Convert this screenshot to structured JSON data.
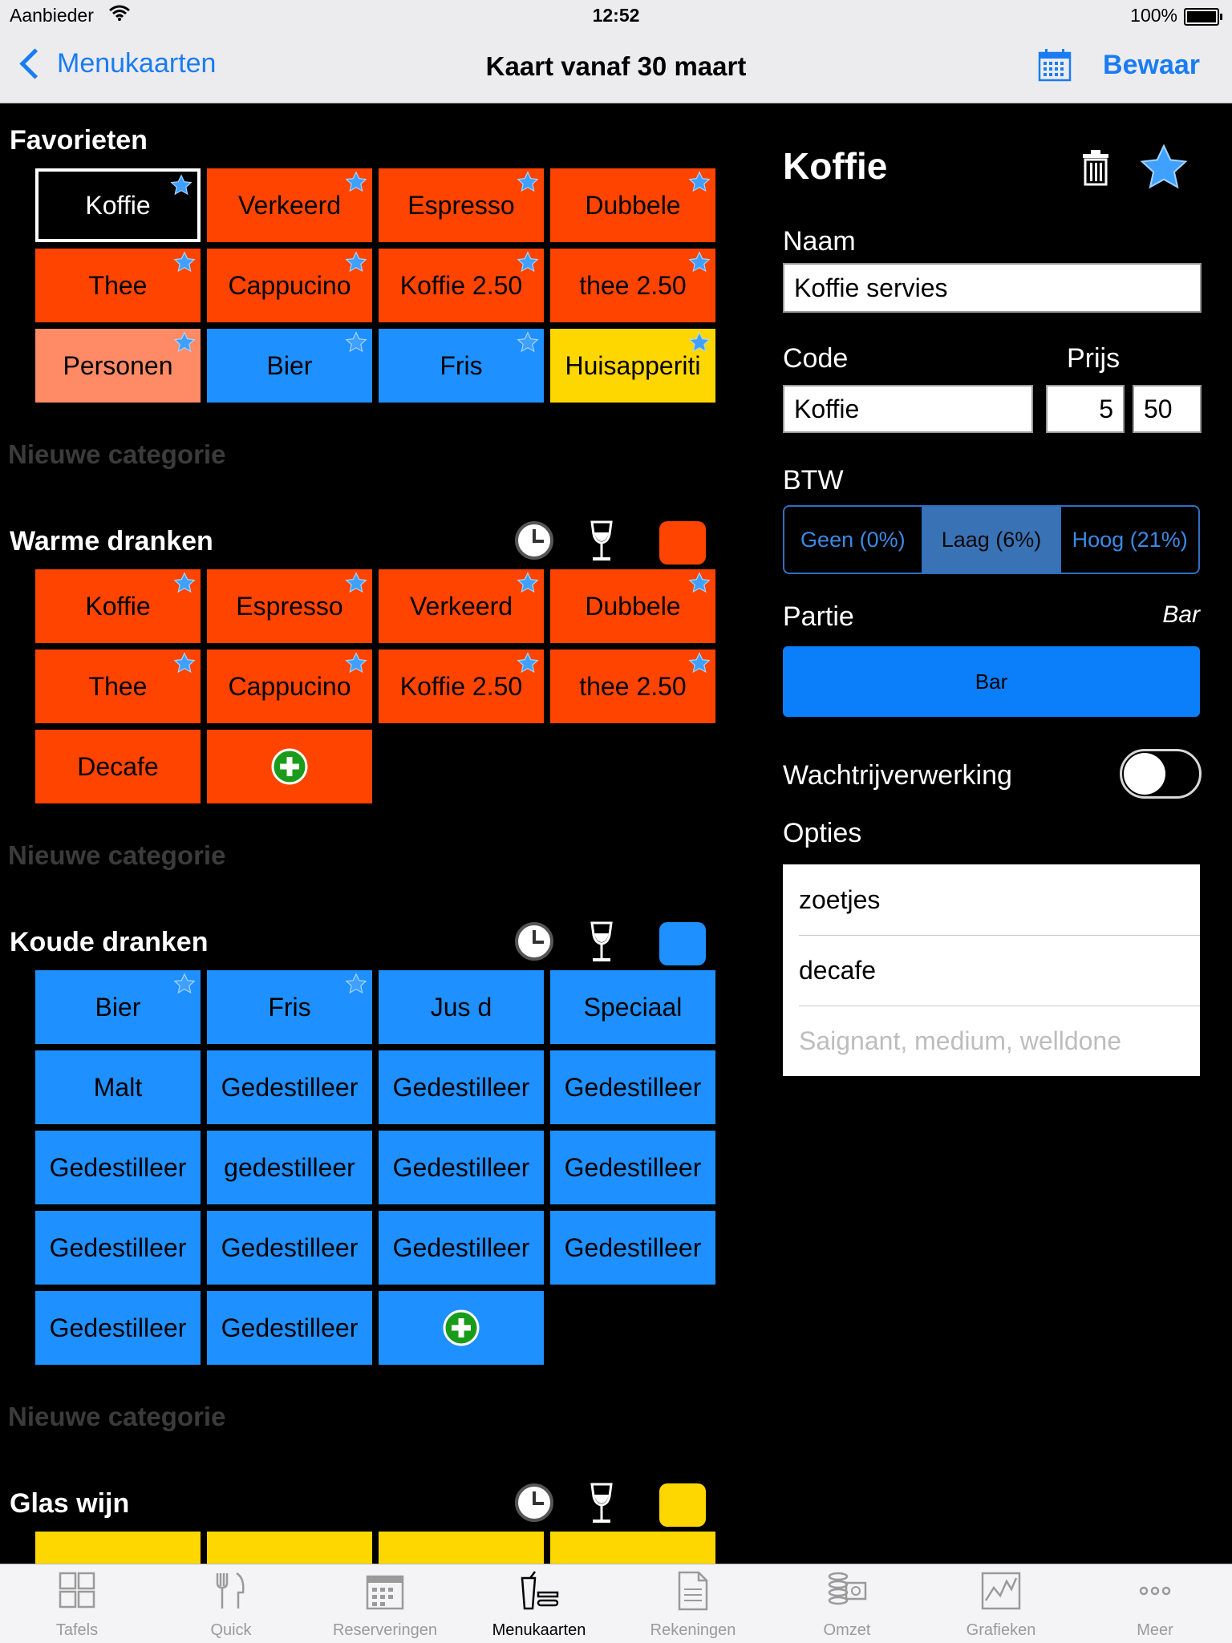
{
  "status": {
    "carrier": "Aanbieder",
    "time": "12:52",
    "battery": "100%"
  },
  "nav": {
    "back_label": "Menukaarten",
    "title": "Kaart vanaf 30 maart",
    "save_label": "Bewaar"
  },
  "colors": {
    "accent": "#1a7cf2",
    "red": "#ff4400",
    "salmon": "#ff8a66",
    "blue": "#1e90ff",
    "yellow": "#ffd700"
  },
  "new_category_label": "Nieuwe categorie",
  "categories": [
    {
      "title": "Favorieten",
      "color": "",
      "items": [
        {
          "label": "Koffie",
          "fav": true,
          "color": "sel"
        },
        {
          "label": "Verkeerd",
          "fav": true,
          "color": "red"
        },
        {
          "label": "Espresso",
          "fav": true,
          "color": "red"
        },
        {
          "label": "Dubbele",
          "fav": true,
          "color": "red"
        },
        {
          "label": "Thee",
          "fav": true,
          "color": "red"
        },
        {
          "label": "Cappucino",
          "fav": true,
          "color": "red"
        },
        {
          "label": "Koffie 2.50",
          "fav": true,
          "color": "red"
        },
        {
          "label": "thee 2.50",
          "fav": true,
          "color": "red"
        },
        {
          "label": "Personen",
          "fav": true,
          "color": "salmon"
        },
        {
          "label": "Bier",
          "fav": true,
          "color": "blue"
        },
        {
          "label": "Fris",
          "fav": true,
          "color": "blue"
        },
        {
          "label": "Huisapperiti",
          "fav": true,
          "color": "yellow"
        }
      ]
    },
    {
      "title": "Warme dranken",
      "color": "#ff4400",
      "items": [
        {
          "label": "Koffie",
          "fav": true,
          "color": "red"
        },
        {
          "label": "Espresso",
          "fav": true,
          "color": "red"
        },
        {
          "label": "Verkeerd",
          "fav": true,
          "color": "red"
        },
        {
          "label": "Dubbele",
          "fav": true,
          "color": "red"
        },
        {
          "label": "Thee",
          "fav": true,
          "color": "red"
        },
        {
          "label": "Cappucino",
          "fav": true,
          "color": "red"
        },
        {
          "label": "Koffie 2.50",
          "fav": true,
          "color": "red"
        },
        {
          "label": "thee 2.50",
          "fav": true,
          "color": "red"
        },
        {
          "label": "Decafe",
          "fav": false,
          "color": "red"
        },
        {
          "label": "",
          "add": true,
          "color": "red"
        }
      ]
    },
    {
      "title": "Koude dranken",
      "color": "#1e90ff",
      "items": [
        {
          "label": "Bier",
          "fav": true,
          "color": "blue"
        },
        {
          "label": "Fris",
          "fav": true,
          "color": "blue"
        },
        {
          "label": "Jus d",
          "fav": false,
          "color": "blue"
        },
        {
          "label": "Speciaal",
          "fav": false,
          "color": "blue"
        },
        {
          "label": "Malt",
          "fav": false,
          "color": "blue"
        },
        {
          "label": "Gedestilleer",
          "fav": false,
          "color": "blue"
        },
        {
          "label": "Gedestilleer",
          "fav": false,
          "color": "blue"
        },
        {
          "label": "Gedestilleer",
          "fav": false,
          "color": "blue"
        },
        {
          "label": "Gedestilleer",
          "fav": false,
          "color": "blue"
        },
        {
          "label": "gedestilleer",
          "fav": false,
          "color": "blue"
        },
        {
          "label": "Gedestilleer",
          "fav": false,
          "color": "blue"
        },
        {
          "label": "Gedestilleer",
          "fav": false,
          "color": "blue"
        },
        {
          "label": "Gedestilleer",
          "fav": false,
          "color": "blue"
        },
        {
          "label": "Gedestilleer",
          "fav": false,
          "color": "blue"
        },
        {
          "label": "Gedestilleer",
          "fav": false,
          "color": "blue"
        },
        {
          "label": "Gedestilleer",
          "fav": false,
          "color": "blue"
        },
        {
          "label": "Gedestilleer",
          "fav": false,
          "color": "blue"
        },
        {
          "label": "Gedestilleer",
          "fav": false,
          "color": "blue"
        },
        {
          "label": "",
          "add": true,
          "color": "blue"
        }
      ]
    },
    {
      "title": "Glas wijn",
      "color": "#ffd700",
      "items": [
        {
          "label": "",
          "color": "yellow"
        },
        {
          "label": "",
          "color": "yellow"
        },
        {
          "label": "",
          "color": "yellow"
        },
        {
          "label": "",
          "color": "yellow"
        }
      ]
    }
  ],
  "detail": {
    "title": "Koffie",
    "naam_label": "Naam",
    "naam_value": "Koffie servies",
    "code_label": "Code",
    "code_value": "Koffie",
    "prijs_label": "Prijs",
    "prijs_euro": "5",
    "prijs_cent": "50",
    "btw_label": "BTW",
    "btw_options": [
      "Geen (0%)",
      "Laag (6%)",
      "Hoog (21%)"
    ],
    "btw_selected": "Laag (6%)",
    "partie_label": "Partie",
    "partie_value": "Bar",
    "partie_button": "Bar",
    "queue_label": "Wachtrijverwerking",
    "queue_on": false,
    "options_label": "Opties",
    "options": [
      "zoetjes",
      "decafe"
    ],
    "options_placeholder": "Saignant, medium, welldone"
  },
  "tabs": [
    {
      "label": "Tafels",
      "icon": "tables-icon"
    },
    {
      "label": "Quick",
      "icon": "fork-knife-icon"
    },
    {
      "label": "Reserveringen",
      "icon": "calendar-icon"
    },
    {
      "label": "Menukaarten",
      "icon": "menu-drink-icon",
      "active": true
    },
    {
      "label": "Rekeningen",
      "icon": "document-icon"
    },
    {
      "label": "Omzet",
      "icon": "coins-icon"
    },
    {
      "label": "Grafieken",
      "icon": "chart-icon"
    },
    {
      "label": "Meer",
      "icon": "more-icon"
    }
  ]
}
